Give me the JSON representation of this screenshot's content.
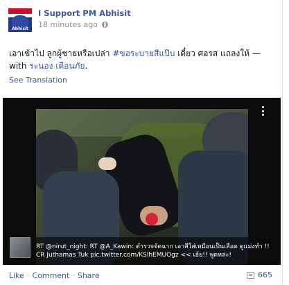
{
  "post": {
    "page_name": "I Support PM Abhisit",
    "timestamp": "18 minutes ago",
    "avatar_text": "Abhisit",
    "status_prefix": "เอาเข้าไป ลูกผู้ชายหรือเปล่า ",
    "hashtag": "#ขอระบายสีแป๊บ",
    "status_mid": " เดี๋ยว ศอรส แถลงให้ — with ",
    "with_name": "ระนอง เตือนภัย",
    "status_suffix": ".",
    "see_translation": "See Translation"
  },
  "media": {
    "caption_line1": "RT @nirut_night: RT @A_Kawin: ตำรวจจัดฉาก เอาสีใส่เหมือนเป็นเลือด ดูแม่งทำ !!",
    "caption_line2": "CR  Juthamas Tuk pic.twitter.com/KSlhEMUOgz << เฮ้ย!! พูดหล่ะ!"
  },
  "footer": {
    "like": "Like",
    "comment": "Comment",
    "share": "Share",
    "share_count": "665"
  },
  "icons": {
    "privacy": "globe-icon",
    "more": "more-icon",
    "shares": "share-icon"
  }
}
